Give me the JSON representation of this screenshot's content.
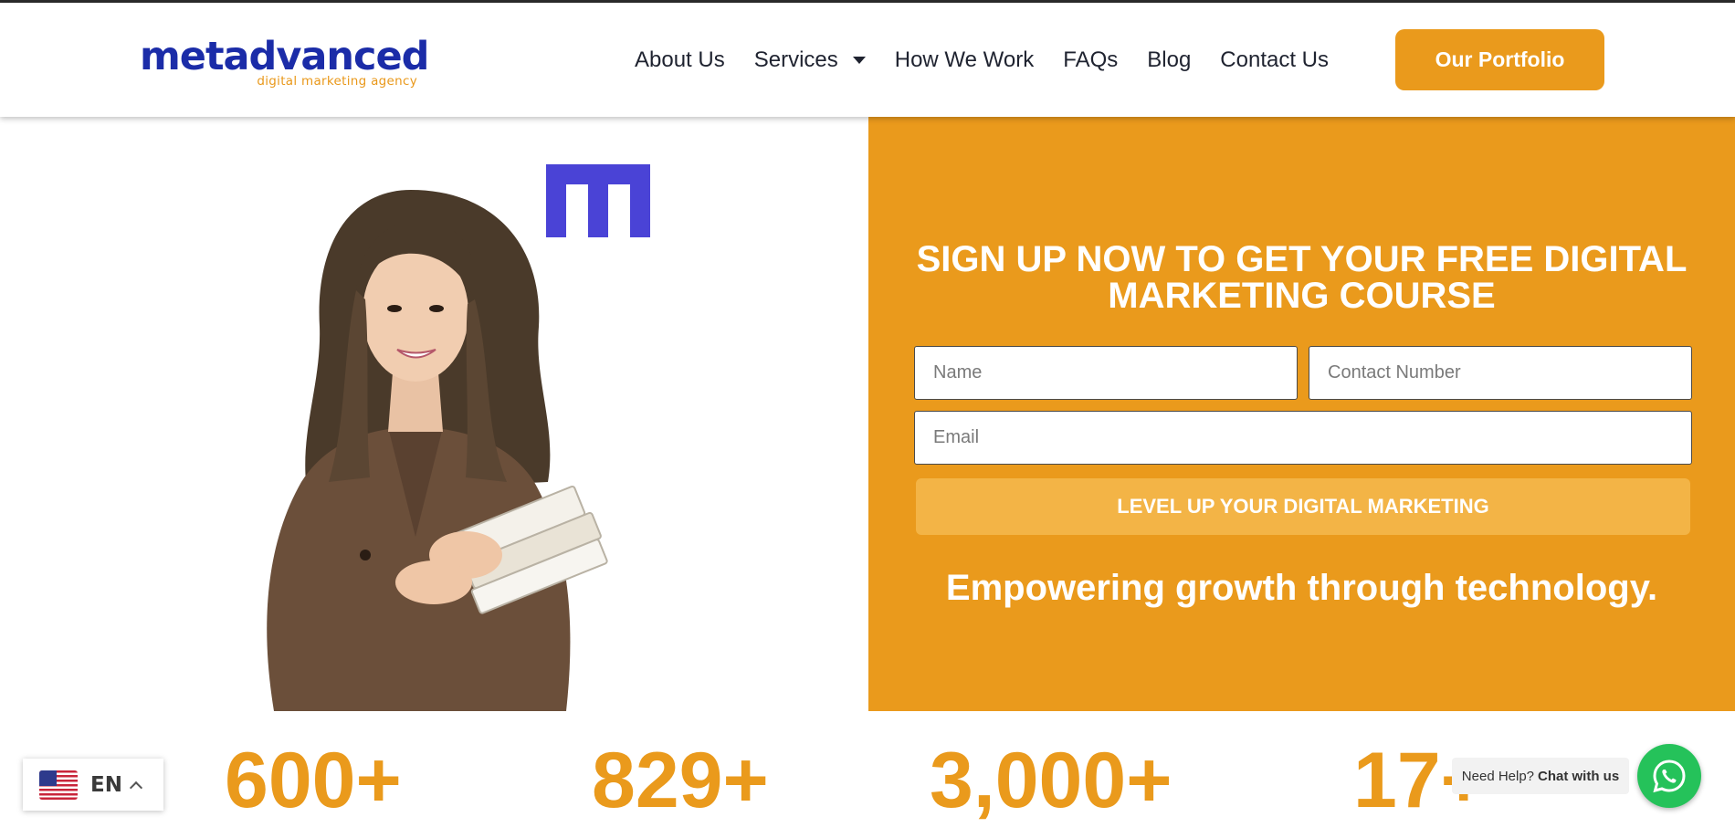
{
  "brand": {
    "name": "metadvanced",
    "tagline": "digital marketing agency",
    "primary_color": "#1b2ca8",
    "accent_color": "#ea9a1c"
  },
  "nav": {
    "items": [
      {
        "label": "About Us",
        "has_dropdown": false
      },
      {
        "label": "Services",
        "has_dropdown": true
      },
      {
        "label": "How We Work",
        "has_dropdown": false
      },
      {
        "label": "FAQs",
        "has_dropdown": false
      },
      {
        "label": "Blog",
        "has_dropdown": false
      },
      {
        "label": "Contact Us",
        "has_dropdown": false
      }
    ],
    "cta_label": "Our Portfolio"
  },
  "hero": {
    "image_icon": "woman-holding-books-image",
    "logo_mark_icon": "m-logo-mark-icon"
  },
  "signup": {
    "title": "SIGN UP NOW TO GET YOUR FREE DIGITAL MARKETING COURSE",
    "name_placeholder": "Name",
    "contact_placeholder": "Contact Number",
    "email_placeholder": "Email",
    "submit_label": "LEVEL UP YOUR DIGITAL MARKETING",
    "tagline": "Empowering growth through technology."
  },
  "stats": [
    "600+",
    "829+",
    "3,000+",
    "17+"
  ],
  "language": {
    "code": "EN",
    "flag_icon": "us-flag-icon"
  },
  "chat": {
    "prefix": "Need Help?",
    "action": "Chat with us",
    "icon": "whatsapp-icon",
    "color": "#25c25a"
  }
}
